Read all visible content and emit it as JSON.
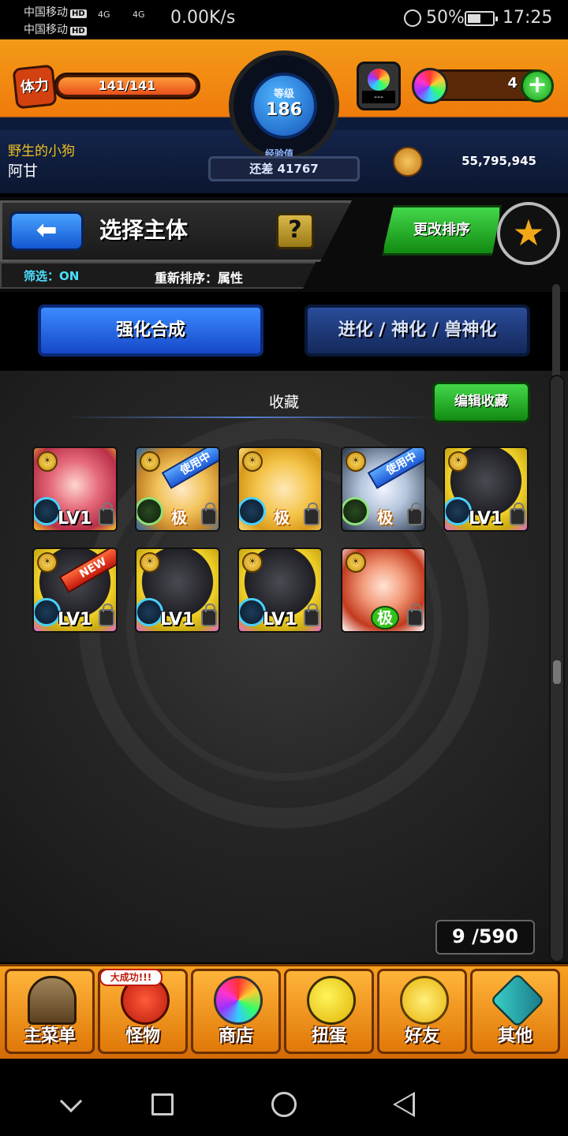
{
  "status_bar": {
    "carrier1": "中国移动",
    "carrier2": "中国移动",
    "hd_label": "HD",
    "network": "4G",
    "speed": "0.00K/s",
    "battery": "50%",
    "time": "17:25"
  },
  "header": {
    "stamina_label": "体力",
    "stamina": "141/141",
    "rank_label": "等级",
    "rank": "186",
    "exp_label": "经验值",
    "exp_remaining": "还差 41767",
    "stone_status": "---",
    "gems": "4",
    "player_title": "野生的小狗",
    "player_name": "阿甘",
    "coins": "55,795,945"
  },
  "nav": {
    "page_title": "选择主体",
    "help": "?",
    "filter": "筛选：ON",
    "sort": "重新排序：属性",
    "change_sort": "更改排序"
  },
  "tabs": {
    "strengthen": "强化合成",
    "evolve": "进化 / 神化 / 兽神化"
  },
  "collection": {
    "title": "收藏",
    "edit_button": "编辑收藏",
    "count": "9 /590"
  },
  "monsters": [
    {
      "art": "pink",
      "element": "water",
      "level": "LV1",
      "tag": "",
      "ult": ""
    },
    {
      "art": "blonde",
      "element": "wood",
      "level": "",
      "tag": "使用中",
      "ult": "极"
    },
    {
      "art": "gold",
      "element": "water",
      "level": "",
      "tag": "",
      "ult": "极"
    },
    {
      "art": "robot",
      "element": "wood",
      "level": "",
      "tag": "使用中",
      "ult": "极"
    },
    {
      "art": "knight",
      "element": "water",
      "level": "LV1",
      "tag": "",
      "ult": ""
    },
    {
      "art": "knight",
      "element": "water",
      "level": "LV1",
      "tag": "NEW",
      "ult": ""
    },
    {
      "art": "knight",
      "element": "water",
      "level": "LV1",
      "tag": "",
      "ult": ""
    },
    {
      "art": "knight",
      "element": "water",
      "level": "LV1",
      "tag": "",
      "ult": ""
    },
    {
      "art": "red",
      "element": "none",
      "level": "",
      "tag": "",
      "ult": "极"
    }
  ],
  "bottom_nav": {
    "badge": "大成功!!!",
    "items": [
      "主菜单",
      "怪物",
      "商店",
      "扭蛋",
      "好友",
      "其他"
    ]
  }
}
